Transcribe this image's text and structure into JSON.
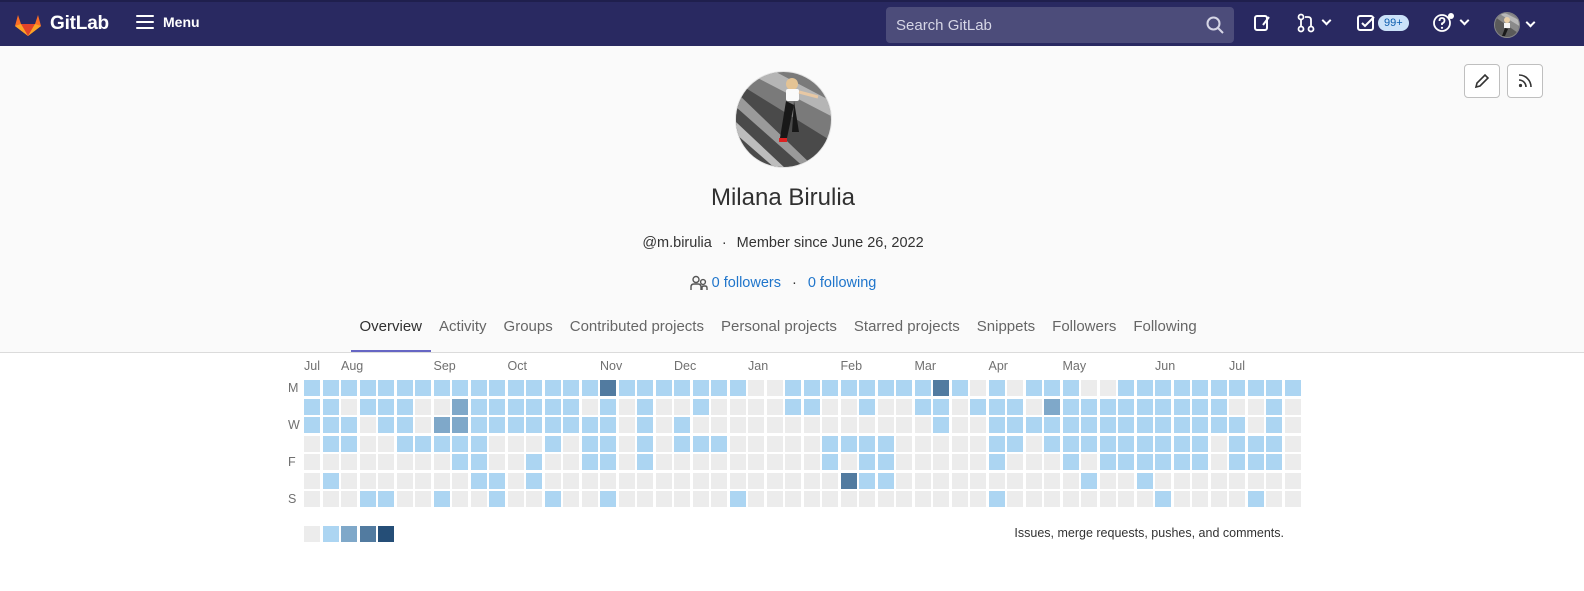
{
  "brand": {
    "name": "GitLab"
  },
  "topbar": {
    "menu_label": "Menu",
    "search_placeholder": "Search GitLab",
    "todos_badge": "99+"
  },
  "profile": {
    "name": "Milana Birulia",
    "username": "@m.birulia",
    "member_since": "Member since June 26, 2022",
    "followers": "0 followers",
    "following": "0 following",
    "separator": "·"
  },
  "tabs": [
    "Overview",
    "Activity",
    "Groups",
    "Contributed projects",
    "Personal projects",
    "Starred projects",
    "Snippets",
    "Followers",
    "Following"
  ],
  "calendar": {
    "months": [
      {
        "label": "Jul",
        "week": 0
      },
      {
        "label": "Aug",
        "week": 2
      },
      {
        "label": "Sep",
        "week": 7
      },
      {
        "label": "Oct",
        "week": 11
      },
      {
        "label": "Nov",
        "week": 16
      },
      {
        "label": "Dec",
        "week": 20
      },
      {
        "label": "Jan",
        "week": 24
      },
      {
        "label": "Feb",
        "week": 29
      },
      {
        "label": "Mar",
        "week": 33
      },
      {
        "label": "Apr",
        "week": 37
      },
      {
        "label": "May",
        "week": 41
      },
      {
        "label": "Jun",
        "week": 46
      },
      {
        "label": "Jul",
        "week": 50
      }
    ],
    "day_labels": [
      {
        "label": "M",
        "row": 0
      },
      {
        "label": "W",
        "row": 2
      },
      {
        "label": "F",
        "row": 4
      },
      {
        "label": "S",
        "row": 6
      }
    ],
    "levels": [
      "#ececec",
      "#acd5f2",
      "#7fa8c9",
      "#527ba0",
      "#254e77"
    ],
    "weeks": [
      "1110000",
      "1111010",
      "1011000",
      "1100001",
      "1110001",
      "1111000",
      "1001000",
      "1021001",
      "1221100",
      "1111110",
      "1110011",
      "1110000",
      "1110110",
      "1111001",
      "1110000",
      "1011100",
      "3111101",
      "1000000",
      "1111100",
      "1000000",
      "1011000",
      "1101000",
      "1001000",
      "1000001",
      "0000000",
      "0000000",
      "1100000",
      "1100000",
      "1001100",
      "1001030",
      "1101110",
      "1001110",
      "1000000",
      "1100000",
      "3110000",
      "1000000",
      "0100000",
      "1111101",
      "0111000",
      "1010000",
      "1211000",
      "1111100",
      "0111010",
      "0111100",
      "1111100",
      "1111110",
      "1111101",
      "1111100",
      "1111100",
      "1110000",
      "1011100",
      "1001101",
      "1111100",
      "1000000"
    ],
    "legend_text": "Issues, merge requests, pushes, and comments."
  }
}
